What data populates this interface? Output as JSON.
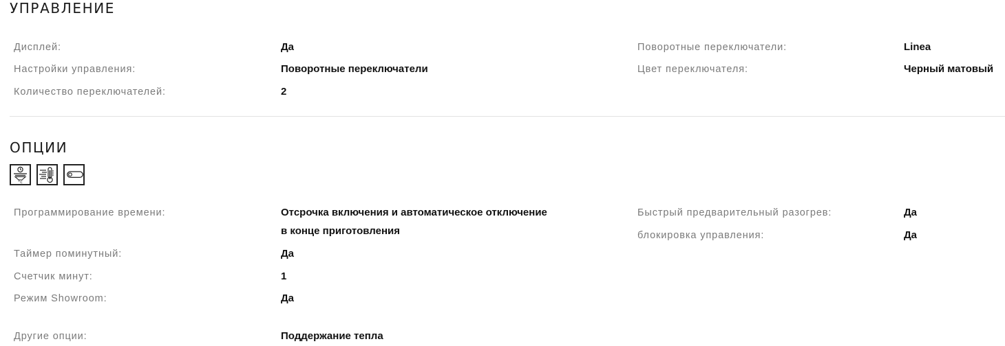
{
  "control": {
    "title": "УПРАВЛЕНИЕ",
    "left": [
      {
        "label": "Дисплей:",
        "value": "Да"
      },
      {
        "label": "Настройки управления:",
        "value": "Поворотные переключатели"
      },
      {
        "label": "Количество переключателей:",
        "value": "2"
      }
    ],
    "right": [
      {
        "label": "Поворотные переключатели:",
        "value": "Linea"
      },
      {
        "label": "Цвет переключателя:",
        "value": "Черный матовый"
      }
    ]
  },
  "options": {
    "title": "ОПЦИИ",
    "icons": [
      "timer-temperature-icon",
      "thermometer-heat-icon",
      "child-lock-icon"
    ],
    "left": [
      {
        "label": "Программирование времени:",
        "value_line1": "Отсрочка включения и автоматическое отключение",
        "value_line2": "в конце приготовления"
      },
      {
        "label": "Таймер поминутный:",
        "value": "Да"
      },
      {
        "label": "Счетчик минут:",
        "value": "1"
      },
      {
        "label": "Режим Showroom:",
        "value": "Да"
      },
      {
        "label": "Другие опции:",
        "value": "Поддержание тепла"
      }
    ],
    "right": [
      {
        "label": "Быстрый предварительный разогрев:",
        "value": "Да"
      },
      {
        "label": "блокировка управления:",
        "value": "Да"
      }
    ]
  }
}
